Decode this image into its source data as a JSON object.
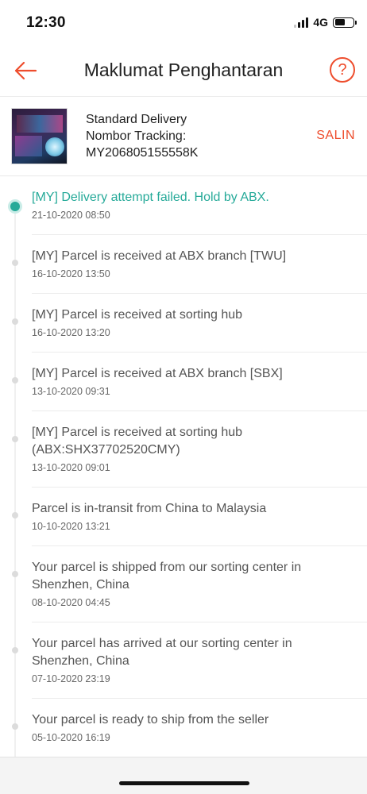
{
  "status_bar": {
    "time": "12:30",
    "network": "4G",
    "icons": [
      "cellular-signal-icon",
      "battery-icon"
    ]
  },
  "header": {
    "title": "Maklumat Penghantaran",
    "back_icon": "arrow-left-icon",
    "help_icon": "question-circle-icon",
    "help_glyph": "?"
  },
  "shipment": {
    "delivery_type": "Standard Delivery",
    "tracking_label": "Nombor Tracking:",
    "tracking_number": "MY206805155558K",
    "copy_label": "SALIN"
  },
  "timeline": [
    {
      "description": "[MY] Delivery attempt failed. Hold by ABX.",
      "time": "21-10-2020 08:50",
      "active": true
    },
    {
      "description": "[MY] Parcel is received at ABX branch [TWU]",
      "time": "16-10-2020 13:50",
      "active": false
    },
    {
      "description": "[MY] Parcel is received at sorting hub",
      "time": "16-10-2020 13:20",
      "active": false
    },
    {
      "description": "[MY] Parcel is received at ABX branch [SBX]",
      "time": "13-10-2020 09:31",
      "active": false
    },
    {
      "description": "[MY] Parcel is received at sorting hub (ABX:SHX37702520CMY)",
      "time": "13-10-2020 09:01",
      "active": false
    },
    {
      "description": "Parcel is in-transit from China to Malaysia",
      "time": "10-10-2020 13:21",
      "active": false
    },
    {
      "description": "Your parcel is shipped from our sorting center in Shenzhen, China",
      "time": "08-10-2020 04:45",
      "active": false
    },
    {
      "description": "Your parcel has arrived at our sorting center in Shenzhen, China",
      "time": "07-10-2020 23:19",
      "active": false
    },
    {
      "description": "Your parcel is ready to ship from the seller",
      "time": "05-10-2020 16:19",
      "active": false
    }
  ],
  "colors": {
    "accent": "#ee4d2d",
    "active": "#26aa99",
    "inactive_dot": "#dcdcdc"
  }
}
